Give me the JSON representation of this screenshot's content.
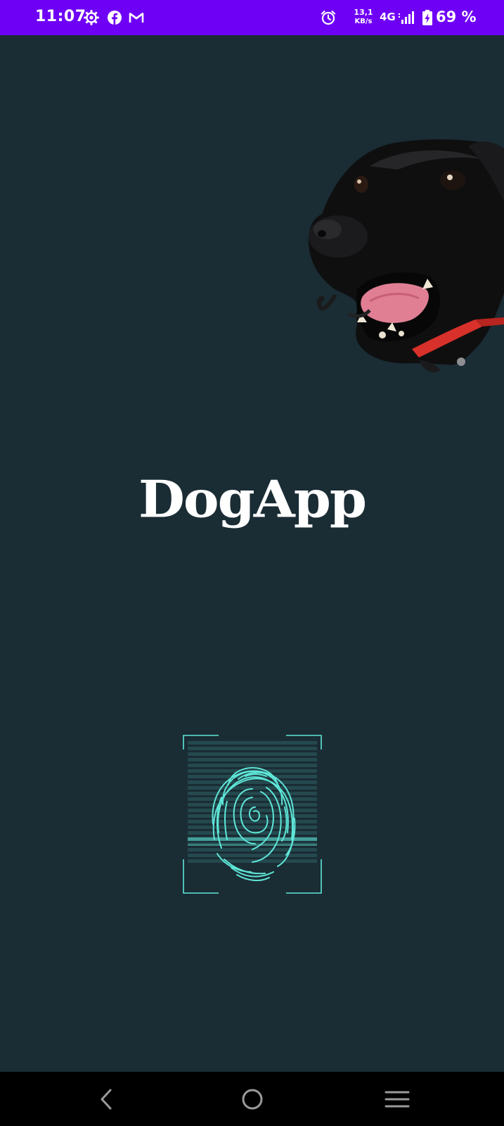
{
  "status_bar": {
    "time": "11:07",
    "network_speed_value": "13,1",
    "network_speed_unit": "KB/s",
    "network_type": "4G",
    "battery_level": "69 %",
    "background_color": "#6f00f6",
    "left_icons": [
      "settings-gear-icon",
      "facebook-icon",
      "gmail-icon"
    ],
    "right_icons": [
      "alarm-icon",
      "signal-bars-icon",
      "battery-charging-icon"
    ]
  },
  "main": {
    "app_title": "DogApp",
    "background_color": "#1a2c34",
    "fingerprint_accent_color": "#5ee6d8"
  },
  "nav_bar": {
    "buttons": [
      "back-icon",
      "home-icon",
      "recents-menu-icon"
    ]
  }
}
